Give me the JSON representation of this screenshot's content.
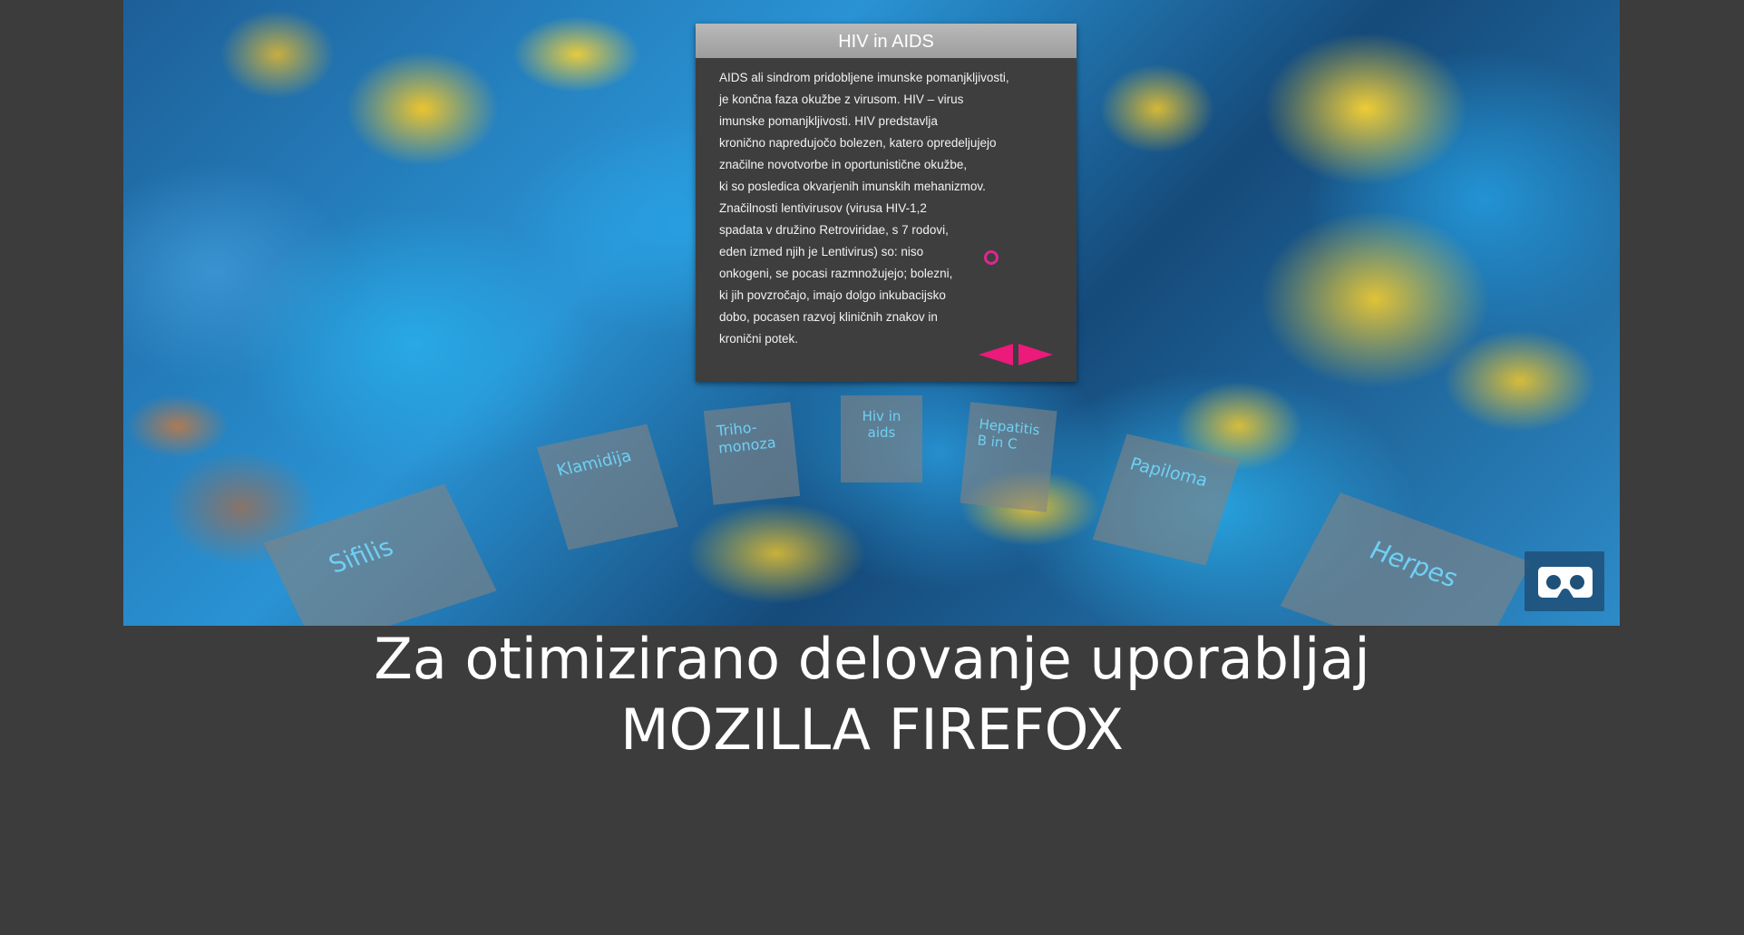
{
  "panel": {
    "title": "HIV in AIDS",
    "lines": [
      "AIDS ali sindrom pridobljene imunske pomanjkljivosti,",
      "je končna faza okužbe z virusom. HIV – virus",
      "imunske pomanjkljivosti. HIV predstavlja",
      "kronično napredujočo bolezen, katero opredeljujejo",
      "značilne novotvorbe in oportunistične okužbe,",
      "ki so posledica okvarjenih imunskih mehanizmov.",
      "Značilnosti lentivirusov (virusa HIV-1,2",
      "spadata v družino Retroviridae, s 7 rodovi,",
      "eden izmed njih je Lentivirus) so: niso",
      "onkogeni, se pocasi razmnožujejo; bolezni,",
      "ki jih povzročajo, imajo dolgo inkubacijsko",
      "dobo, pocasen razvoj kliničnih znakov in",
      "kronični potek."
    ],
    "accent_color": "#ec1a7b"
  },
  "cards": [
    {
      "label": "Sifilis"
    },
    {
      "label": "Klamidija"
    },
    {
      "label_line1": "Triho-",
      "label_line2": "monoza"
    },
    {
      "label_line1": "Hiv in",
      "label_line2": "aids"
    },
    {
      "label_line1": "Hepatitis",
      "label_line2": "B in C"
    },
    {
      "label": "Papiloma"
    },
    {
      "label": "Herpes"
    }
  ],
  "vr_button": {
    "icon": "vr-goggles-icon"
  },
  "footer": {
    "line1": "Za otimizirano delovanje uporabljaj",
    "line2": "MOZILLA  FIREFOX"
  },
  "colors": {
    "background": "#3c3c3c",
    "card_text": "#6fd0f5"
  }
}
